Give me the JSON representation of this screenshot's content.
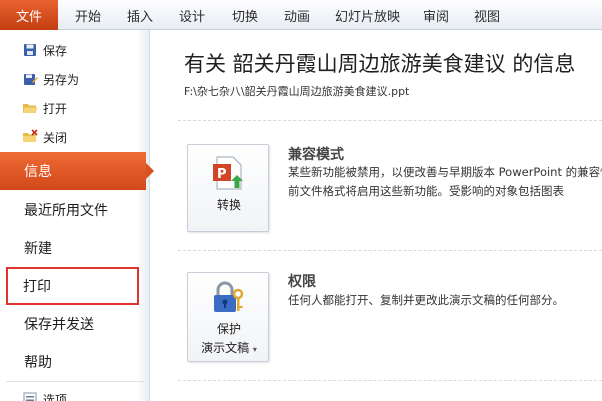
{
  "ribbon": {
    "file_tab": "文件",
    "tabs": [
      "开始",
      "插入",
      "设计",
      "切换",
      "动画",
      "幻灯片放映",
      "审阅",
      "视图"
    ]
  },
  "nav": {
    "save": "保存",
    "save_as": "另存为",
    "open": "打开",
    "close": "关闭",
    "info": "信息",
    "recent": "最近所用文件",
    "new": "新建",
    "print": "打印",
    "save_send": "保存并发送",
    "help": "帮助",
    "options": "选项"
  },
  "info": {
    "title": "有关 韶关丹霞山周边旅游美食建议 的信息",
    "path": "F:\\杂七杂八\\韶关丹霞山周边旅游美食建议.ppt",
    "compat": {
      "button_label": "转换",
      "title": "兼容模式",
      "line1": "某些新功能被禁用，以便改善与早期版本 PowerPoint 的兼容性",
      "line2": "前文件格式将启用这些新功能。受影响的对象包括图表"
    },
    "perm": {
      "button_label1": "保护",
      "button_label2": "演示文稿",
      "title": "权限",
      "line1": "任何人都能打开、复制并更改此演示文稿的任何部分。"
    }
  },
  "colors": {
    "accent": "#d9511f",
    "highlight_border": "#e0332b"
  }
}
